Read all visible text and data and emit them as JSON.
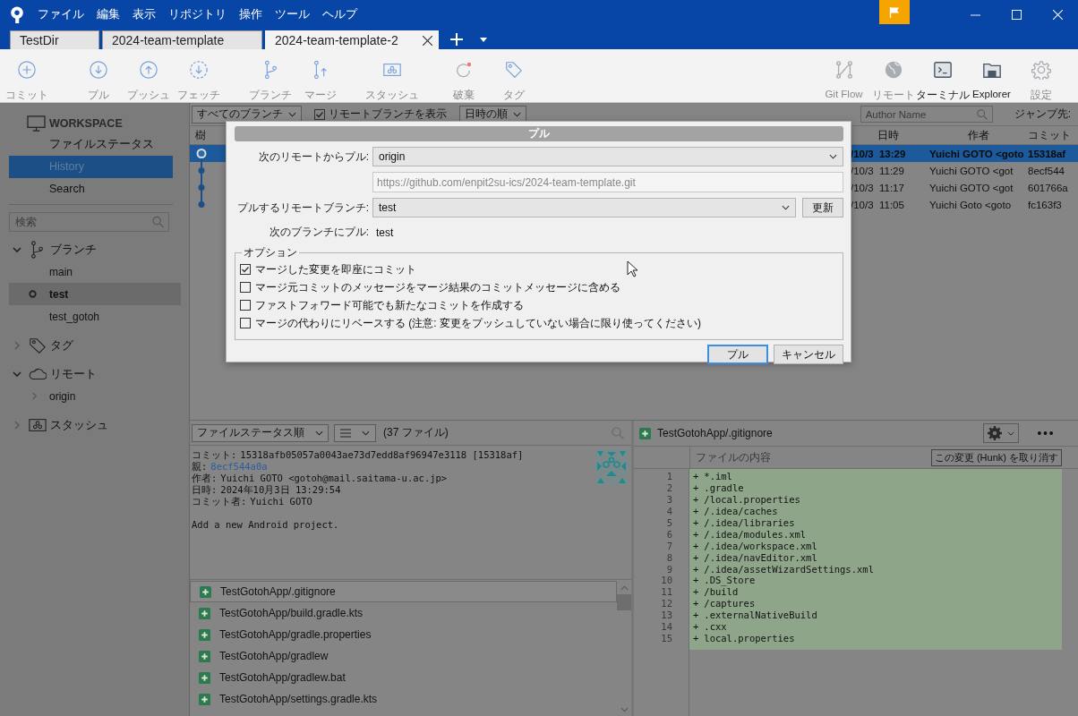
{
  "menu": [
    "ファイル",
    "編集",
    "表示",
    "リポジトリ",
    "操作",
    "ツール",
    "ヘルプ"
  ],
  "tabs": [
    {
      "label": "TestDir",
      "selected": false
    },
    {
      "label": "2024-team-template",
      "selected": false
    },
    {
      "label": "2024-team-template-2",
      "selected": true
    }
  ],
  "toolbar": {
    "groups": [
      [
        {
          "label": "コミット",
          "enabled": false
        }
      ],
      [
        {
          "label": "プル",
          "enabled": false
        },
        {
          "label": "プッシュ",
          "enabled": false
        },
        {
          "label": "フェッチ",
          "enabled": false
        }
      ],
      [
        {
          "label": "ブランチ",
          "enabled": false
        },
        {
          "label": "マージ",
          "enabled": false
        }
      ],
      [
        {
          "label": "スタッシュ",
          "enabled": false
        }
      ],
      [
        {
          "label": "破棄",
          "enabled": false
        },
        {
          "label": "タグ",
          "enabled": false
        }
      ]
    ],
    "right": [
      {
        "label": "Git Flow",
        "enabled": false
      },
      {
        "label": "リモート",
        "enabled": false
      },
      {
        "label": "ターミナル",
        "enabled": true
      },
      {
        "label": "Explorer",
        "enabled": true
      },
      {
        "label": "設定",
        "enabled": false
      }
    ]
  },
  "sidebar": {
    "workspace": {
      "title": "WORKSPACE",
      "items": [
        {
          "label": "ファイルステータス",
          "selected": false
        },
        {
          "label": "History",
          "selected": true
        },
        {
          "label": "Search",
          "selected": false
        }
      ]
    },
    "search": {
      "placeholder": "検索"
    },
    "sections": [
      {
        "label": "ブランチ",
        "expanded": true,
        "children": [
          {
            "label": "main",
            "current": false,
            "selected": false
          },
          {
            "label": "test",
            "current": true,
            "selected": true
          },
          {
            "label": "test_gotoh",
            "current": false,
            "selected": false
          }
        ]
      },
      {
        "label": "タグ",
        "expanded": false
      },
      {
        "label": "リモート",
        "expanded": true,
        "children": [
          {
            "label": "origin",
            "expanded": false,
            "selected": false
          }
        ]
      },
      {
        "label": "スタッシュ",
        "expanded": false
      }
    ]
  },
  "filters": {
    "branch_dropdown": "すべてのブランチ",
    "show_remote": {
      "label": "リモートブランチを表示",
      "checked": true
    },
    "sort_dropdown": "日時の順",
    "author_search": {
      "placeholder": "Author Name"
    },
    "jump_label": "ジャンプ先:"
  },
  "commits": {
    "columns": [
      "樹",
      "日時",
      "作者",
      "コミット"
    ],
    "rows": [
      {
        "head": true,
        "date": "/10/3  13:29",
        "author": "Yuichi GOTO <goto",
        "hash": "15318af",
        "selected": true
      },
      {
        "head": false,
        "date": "/10/3  11:29",
        "author": "Yuichi GOTO <got",
        "hash": "8ecf544",
        "selected": false
      },
      {
        "head": false,
        "date": "/10/3  11:17",
        "author": "Yuichi GOTO <got",
        "hash": "601766a",
        "selected": false
      },
      {
        "head": false,
        "date": "/10/3  11:05",
        "author": "Yuichi Goto <goto",
        "hash": "fc163f3",
        "selected": false
      }
    ]
  },
  "file_toolbar": {
    "sort_dropdown": "ファイルステータス順",
    "count": "(37 ファイル)"
  },
  "details": [
    {
      "label": "コミット:",
      "value": "15318afb05057a0043ae73d7edd8af96947e3118 [15318af]",
      "kind": "text"
    },
    {
      "label": "親:",
      "value": "8ecf544a0a",
      "kind": "link"
    },
    {
      "label": "作者:",
      "value": "Yuichi GOTO <gotoh@mail.saitama-u.ac.jp>",
      "kind": "text"
    },
    {
      "label": "日時:",
      "value": "2024年10月3日 13:29:54",
      "kind": "text"
    },
    {
      "label": "コミット者:",
      "value": "Yuichi GOTO",
      "kind": "text"
    }
  ],
  "message": "Add a new Android project.",
  "files": [
    {
      "path": "TestGotohApp/.gitignore",
      "selected": true
    },
    {
      "path": "TestGotohApp/build.gradle.kts",
      "selected": false
    },
    {
      "path": "TestGotohApp/gradle.properties",
      "selected": false
    },
    {
      "path": "TestGotohApp/gradlew",
      "selected": false
    },
    {
      "path": "TestGotohApp/gradlew.bat",
      "selected": false
    },
    {
      "path": "TestGotohApp/settings.gradle.kts",
      "selected": false
    }
  ],
  "diff": {
    "file": "TestGotohApp/.gitignore",
    "column_title": "ファイルの内容",
    "hunk_button": "この変更 (Hunk) を取り消す",
    "lines": [
      {
        "number": "1",
        "sign": "+",
        "text": "*.iml"
      },
      {
        "number": "2",
        "sign": "+",
        "text": ".gradle"
      },
      {
        "number": "3",
        "sign": "+",
        "text": "/local.properties"
      },
      {
        "number": "4",
        "sign": "+",
        "text": "/.idea/caches"
      },
      {
        "number": "5",
        "sign": "+",
        "text": "/.idea/libraries"
      },
      {
        "number": "6",
        "sign": "+",
        "text": "/.idea/modules.xml"
      },
      {
        "number": "7",
        "sign": "+",
        "text": "/.idea/workspace.xml"
      },
      {
        "number": "8",
        "sign": "+",
        "text": "/.idea/navEditor.xml"
      },
      {
        "number": "9",
        "sign": "+",
        "text": "/.idea/assetWizardSettings.xml"
      },
      {
        "number": "10",
        "sign": "+",
        "text": ".DS_Store"
      },
      {
        "number": "11",
        "sign": "+",
        "text": "/build"
      },
      {
        "number": "12",
        "sign": "+",
        "text": "/captures"
      },
      {
        "number": "13",
        "sign": "+",
        "text": ".externalNativeBuild"
      },
      {
        "number": "14",
        "sign": "+",
        "text": ".cxx"
      },
      {
        "number": "15",
        "sign": "+",
        "text": "local.properties"
      }
    ]
  },
  "dialog": {
    "title": "プル",
    "remote_label": "次のリモートからプル:",
    "remote": "origin",
    "remote_url": "https://github.com/enpit2su-ics/2024-team-template.git",
    "branch_label": "プルするリモートブランチ:",
    "branch": "test",
    "refresh_button": "更新",
    "target_label": "次のブランチにプル:",
    "target": "test",
    "options_title": "オプション",
    "options": [
      {
        "label": "マージした変更を即座にコミット",
        "checked": true
      },
      {
        "label": "マージ元コミットのメッセージをマージ結果のコミットメッセージに含める",
        "checked": false
      },
      {
        "label": "ファストフォワード可能でも新たなコミットを作成する",
        "checked": false
      },
      {
        "label": "マージの代わりにリベースする (注意: 変更をプッシュしていない場合に限り使ってください)",
        "checked": false
      }
    ],
    "buttons": [
      {
        "label": "プル",
        "default": true
      },
      {
        "label": "キャンセル",
        "default": false
      }
    ]
  }
}
